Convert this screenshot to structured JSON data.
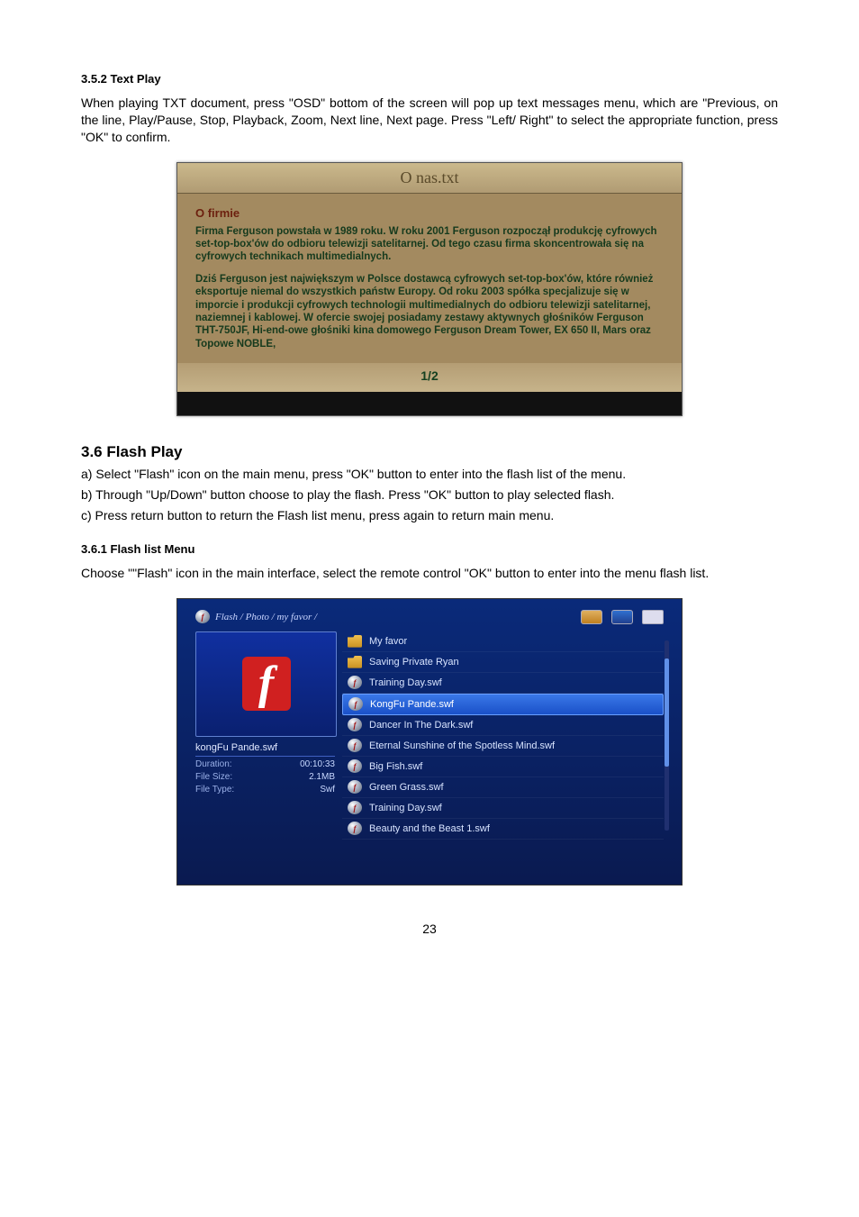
{
  "s352": {
    "heading": "3.5.2 Text Play",
    "para": "When playing TXT document, press \"OSD\" bottom of the screen will pop up text messages menu, which are \"Previous, on the line, Play/Pause, Stop, Playback, Zoom, Next line, Next page. Press \"Left/ Right\" to select the appropriate function, press \"OK\" to confirm."
  },
  "txtshot": {
    "title": "O nas.txt",
    "heading": "O firmie",
    "p1": "Firma Ferguson powstała w 1989 roku. W roku 2001 Ferguson rozpoczął produkcję cyfrowych set-top-box'ów do odbioru telewizji satelitarnej. Od tego czasu firma skoncentrowała się na cyfrowych technikach multimedialnych.",
    "p2": "Dziś Ferguson jest największym w Polsce dostawcą cyfrowych set-top-box'ów, które również eksportuje niemal do wszystkich państw Europy. Od roku 2003 spółka specjalizuje się w imporcie i produkcji cyfrowych technologii multimedialnych do odbioru telewizji satelitarnej, naziemnej i kablowej. W ofercie swojej posiadamy zestawy aktywnych głośników Ferguson THT-750JF, Hi-end-owe głośniki kina domowego Ferguson Dream Tower,  EX 650 II, Mars  oraz Topowe NOBLE,",
    "page": "1/2"
  },
  "s36": {
    "heading": "3.6 Flash Play",
    "a": "a) Select \"Flash\" icon on the main menu, press \"OK\" button to enter into the flash list of the menu.",
    "b": "b) Through \"Up/Down\" button choose to play the flash. Press \"OK\" button to play selected flash.",
    "c": "c) Press return button to return the Flash list menu, press again to return main menu."
  },
  "s361": {
    "heading": "3.6.1 Flash list Menu",
    "para": "Choose \"\"Flash\" icon in the main interface, select the remote control \"OK\" button to enter into the menu flash list."
  },
  "flashshot": {
    "breadcrumb": "Flash / Photo / my favor /",
    "thumb_glyph": "f",
    "thumb_title": "kongFu Pande.swf",
    "meta": {
      "duration_label": "Duration:",
      "duration_value": "00:10:33",
      "filesize_label": "File Size:",
      "filesize_value": "2.1MB",
      "filetype_label": "File Type:",
      "filetype_value": "Swf"
    },
    "items": [
      {
        "kind": "folder",
        "label": "My favor"
      },
      {
        "kind": "folder",
        "label": "Saving Private Ryan"
      },
      {
        "kind": "flash",
        "label": "Training Day.swf"
      },
      {
        "kind": "flash",
        "label": "KongFu Pande.swf",
        "selected": true
      },
      {
        "kind": "flash",
        "label": "Dancer In The Dark.swf"
      },
      {
        "kind": "flash",
        "label": "Eternal Sunshine of the Spotless Mind.swf"
      },
      {
        "kind": "flash",
        "label": "Big Fish.swf"
      },
      {
        "kind": "flash",
        "label": "Green Grass.swf"
      },
      {
        "kind": "flash",
        "label": "Training Day.swf"
      },
      {
        "kind": "flash",
        "label": "Beauty and the Beast 1.swf"
      }
    ]
  },
  "page_number": "23"
}
